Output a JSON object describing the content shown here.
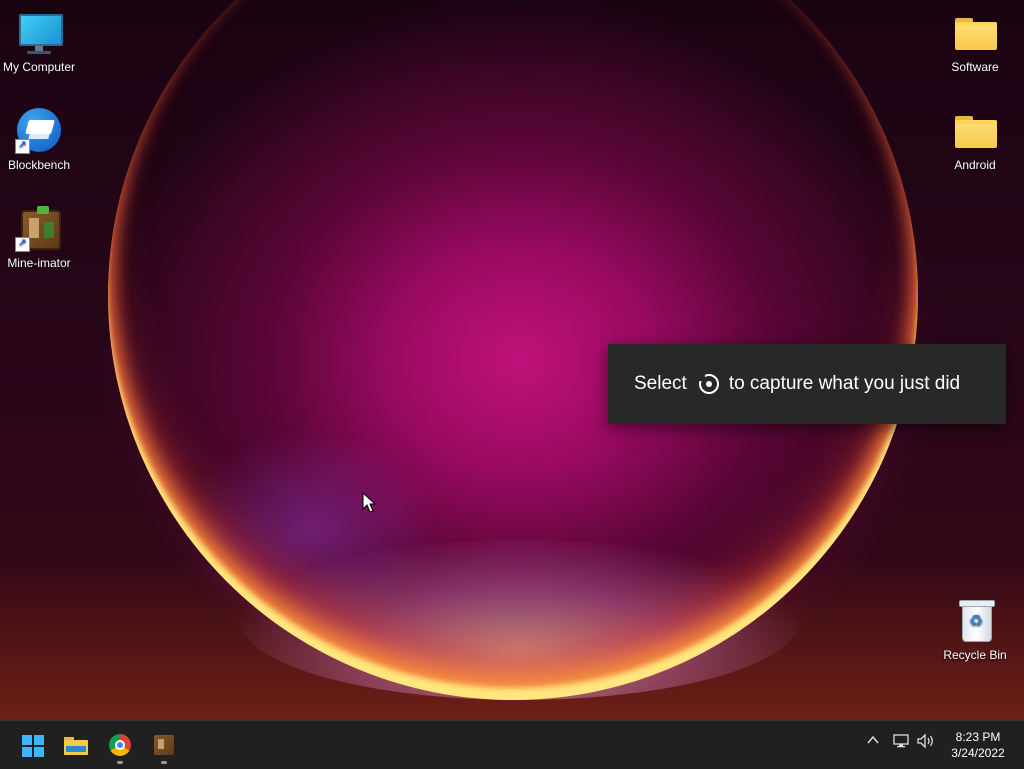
{
  "desktop": {
    "icons_left": [
      {
        "label": "My Computer"
      },
      {
        "label": "Blockbench"
      },
      {
        "label": "Mine-imator"
      }
    ],
    "icons_right": [
      {
        "label": "Software"
      },
      {
        "label": "Android"
      },
      {
        "label": "Recycle Bin"
      }
    ]
  },
  "toast": {
    "text_before": "Select",
    "text_after": "to capture what you just did",
    "icon": "record-icon"
  },
  "taskbar": {
    "apps": [
      {
        "name": "start",
        "icon": "windows-icon"
      },
      {
        "name": "file-explorer",
        "icon": "folder-icon"
      },
      {
        "name": "chrome",
        "icon": "chrome-icon",
        "running": true
      },
      {
        "name": "mine-imator",
        "icon": "mine-imator-icon",
        "running": true
      }
    ],
    "tray": {
      "chevron": "^",
      "network_icon": "network-icon",
      "volume_icon": "volume-icon"
    },
    "clock": {
      "time": "8:23 PM",
      "date": "3/24/2022"
    }
  },
  "colors": {
    "taskbar_bg": "#202020",
    "toast_bg": "#282828",
    "accent": "#3fb4ff"
  }
}
